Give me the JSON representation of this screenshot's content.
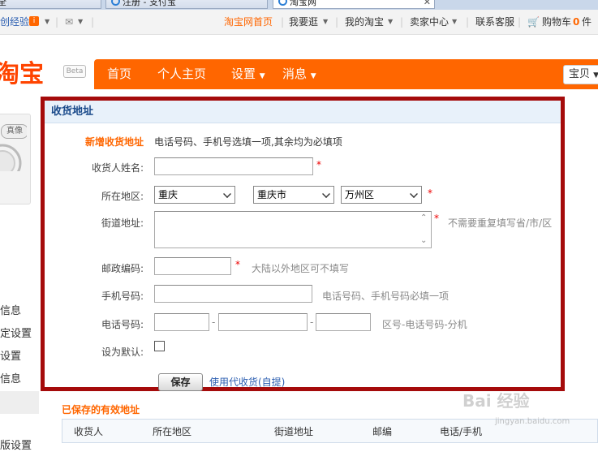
{
  "browser": {
    "tabs": [
      {
        "label": "全"
      },
      {
        "label": "注册 - 支付宝"
      },
      {
        "label": "淘宝网"
      }
    ]
  },
  "topbar": {
    "left_link": "创经验",
    "links": [
      "淘宝网首页",
      "我要逛",
      "我的淘宝",
      "卖家中心",
      "联系客服",
      "购物车"
    ],
    "cart_count": "0",
    "cart_unit": "件",
    "accent_color": "#ff6600"
  },
  "header": {
    "logo_text": "淘宝",
    "beta_badge": "Beta",
    "nav": [
      "首页",
      "个人主页",
      "设置",
      "消息"
    ],
    "search_scope": "宝贝"
  },
  "sidebar": {
    "avatar_text": "真像",
    "items": [
      "信息",
      "定设置",
      "设置",
      "信息",
      "版设置"
    ]
  },
  "address_form": {
    "title": "收货地址",
    "new_label": "新增收货地址",
    "new_hint": "电话号码、手机号选填一项,其余均为必填项",
    "name_label": "收货人姓名:",
    "region_label": "所在地区:",
    "province": "重庆",
    "city": "重庆市",
    "district": "万州区",
    "street_label": "街道地址:",
    "street_hint": "不需要重复填写省/市/区",
    "postcode_label": "邮政编码:",
    "postcode_hint": "大陆以外地区可不填写",
    "mobile_label": "手机号码:",
    "mobile_hint": "电话号码、手机号码必填一项",
    "phone_label": "电话号码:",
    "phone_dash": "-",
    "phone_hint": "区号-电话号码-分机",
    "default_label": "设为默认:",
    "required_mark": "*",
    "save_button": "保存",
    "pickup_link": "使用代收货(自提)"
  },
  "saved": {
    "title": "已保存的有效地址",
    "columns": [
      "收货人",
      "所在地区",
      "街道地址",
      "邮编",
      "电话/手机"
    ]
  },
  "watermark": {
    "text": "Bai 经验",
    "sub": "jingyan.baidu.com"
  }
}
